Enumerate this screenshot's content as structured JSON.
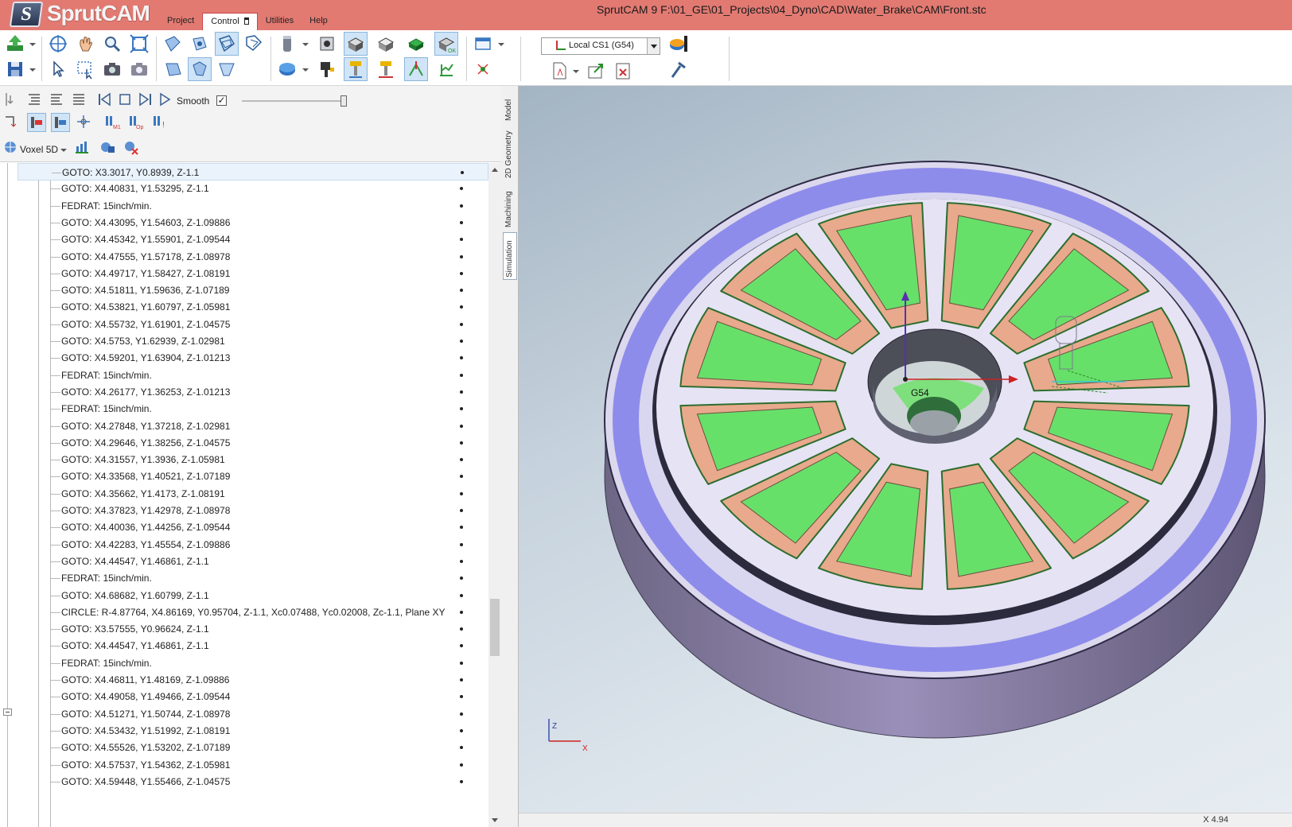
{
  "app": {
    "logo_text": "SprutCAM",
    "window_title": "SprutCAM 9   F:\\01_GE\\01_Projects\\04_Dyno\\CAD\\Water_Brake\\CAM\\Front.stc"
  },
  "menu": [
    {
      "label": "Project"
    },
    {
      "label": "Control"
    },
    {
      "label": "Utilities"
    },
    {
      "label": "Help"
    }
  ],
  "toolbar": {
    "cs_select_value": "Local CS1 (G54)"
  },
  "sim_controls": {
    "smooth_label": "Smooth",
    "smooth_checked": "✓",
    "voxel_label": "Voxel 5D"
  },
  "side_tabs": [
    {
      "label": "Model"
    },
    {
      "label": "2D Geometry"
    },
    {
      "label": "Machining"
    },
    {
      "label": "Simulation"
    }
  ],
  "commands": [
    "GOTO: X3.3017, Y0.8939, Z-1.1",
    "GOTO: X4.40831, Y1.53295, Z-1.1",
    "FEDRAT: 15inch/min.",
    "GOTO: X4.43095, Y1.54603, Z-1.09886",
    "GOTO: X4.45342, Y1.55901, Z-1.09544",
    "GOTO: X4.47555, Y1.57178, Z-1.08978",
    "GOTO: X4.49717, Y1.58427, Z-1.08191",
    "GOTO: X4.51811, Y1.59636, Z-1.07189",
    "GOTO: X4.53821, Y1.60797, Z-1.05981",
    "GOTO: X4.55732, Y1.61901, Z-1.04575",
    "GOTO: X4.5753, Y1.62939, Z-1.02981",
    "GOTO: X4.59201, Y1.63904, Z-1.01213",
    "FEDRAT: 15inch/min.",
    "GOTO: X4.26177, Y1.36253, Z-1.01213",
    "FEDRAT: 15inch/min.",
    "GOTO: X4.27848, Y1.37218, Z-1.02981",
    "GOTO: X4.29646, Y1.38256, Z-1.04575",
    "GOTO: X4.31557, Y1.3936, Z-1.05981",
    "GOTO: X4.33568, Y1.40521, Z-1.07189",
    "GOTO: X4.35662, Y1.4173, Z-1.08191",
    "GOTO: X4.37823, Y1.42978, Z-1.08978",
    "GOTO: X4.40036, Y1.44256, Z-1.09544",
    "GOTO: X4.42283, Y1.45554, Z-1.09886",
    "GOTO: X4.44547, Y1.46861, Z-1.1",
    "FEDRAT: 15inch/min.",
    "GOTO: X4.68682, Y1.60799, Z-1.1",
    "CIRCLE: R-4.87764, X4.86169, Y0.95704, Z-1.1, Xc0.07488, Yc0.02008, Zc-1.1, Plane XY",
    "GOTO: X3.57555, Y0.96624, Z-1.1",
    "GOTO: X4.44547, Y1.46861, Z-1.1",
    "FEDRAT: 15inch/min.",
    "GOTO: X4.46811, Y1.48169, Z-1.09886",
    "GOTO: X4.49058, Y1.49466, Z-1.09544",
    "GOTO: X4.51271, Y1.50744, Z-1.08978",
    "GOTO: X4.53432, Y1.51992, Z-1.08191",
    "GOTO: X4.55526, Y1.53202, Z-1.07189",
    "GOTO: X4.57537, Y1.54362, Z-1.05981",
    "GOTO: X4.59448, Y1.55466, Z-1.04575"
  ],
  "viewport": {
    "cs_label": "G54",
    "triad_z": "Z",
    "triad_x": "X",
    "coord_readout": "X 4.94"
  },
  "colors": {
    "titlebar": "#e27a72",
    "stock": "#8f83aa",
    "pocket_floor": "#67e06a",
    "pocket_wall": "#e8a98c",
    "face": "#e3e0f3",
    "uncut": "#8a88e8"
  }
}
